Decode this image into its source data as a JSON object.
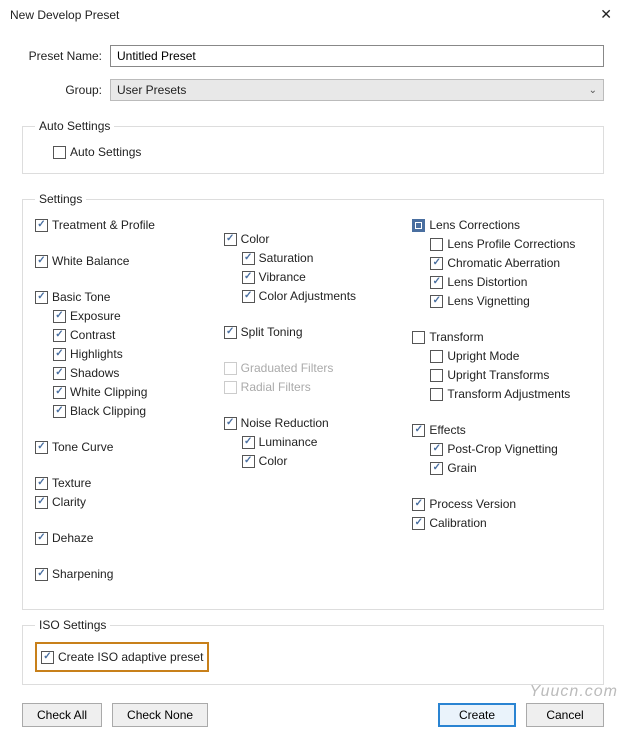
{
  "window": {
    "title": "New Develop Preset"
  },
  "form": {
    "preset_name_label": "Preset Name:",
    "preset_name_value": "Untitled Preset",
    "group_label": "Group:",
    "group_value": "User Presets"
  },
  "auto_settings": {
    "legend": "Auto Settings",
    "auto_settings": {
      "label": "Auto Settings",
      "checked": false
    }
  },
  "settings": {
    "legend": "Settings",
    "col1": {
      "treatment_profile": {
        "label": "Treatment & Profile",
        "checked": true
      },
      "white_balance": {
        "label": "White Balance",
        "checked": true
      },
      "basic_tone": {
        "label": "Basic Tone",
        "checked": true
      },
      "exposure": {
        "label": "Exposure",
        "checked": true
      },
      "contrast": {
        "label": "Contrast",
        "checked": true
      },
      "highlights": {
        "label": "Highlights",
        "checked": true
      },
      "shadows": {
        "label": "Shadows",
        "checked": true
      },
      "white_clipping": {
        "label": "White Clipping",
        "checked": true
      },
      "black_clipping": {
        "label": "Black Clipping",
        "checked": true
      },
      "tone_curve": {
        "label": "Tone Curve",
        "checked": true
      },
      "texture": {
        "label": "Texture",
        "checked": true
      },
      "clarity": {
        "label": "Clarity",
        "checked": true
      },
      "dehaze": {
        "label": "Dehaze",
        "checked": true
      },
      "sharpening": {
        "label": "Sharpening",
        "checked": true
      }
    },
    "col2": {
      "color": {
        "label": "Color",
        "checked": true
      },
      "saturation": {
        "label": "Saturation",
        "checked": true
      },
      "vibrance": {
        "label": "Vibrance",
        "checked": true
      },
      "color_adjustments": {
        "label": "Color Adjustments",
        "checked": true
      },
      "split_toning": {
        "label": "Split Toning",
        "checked": true
      },
      "graduated_filters": {
        "label": "Graduated Filters",
        "checked": false,
        "disabled": true
      },
      "radial_filters": {
        "label": "Radial Filters",
        "checked": false,
        "disabled": true
      },
      "noise_reduction": {
        "label": "Noise Reduction",
        "checked": true
      },
      "luminance": {
        "label": "Luminance",
        "checked": true
      },
      "nr_color": {
        "label": "Color",
        "checked": true
      }
    },
    "col3": {
      "lens_corrections": {
        "label": "Lens Corrections",
        "state": "mixed"
      },
      "lens_profile_corrections": {
        "label": "Lens Profile Corrections",
        "checked": false
      },
      "chromatic_aberration": {
        "label": "Chromatic Aberration",
        "checked": true
      },
      "lens_distortion": {
        "label": "Lens Distortion",
        "checked": true
      },
      "lens_vignetting": {
        "label": "Lens Vignetting",
        "checked": true
      },
      "transform": {
        "label": "Transform",
        "checked": false
      },
      "upright_mode": {
        "label": "Upright Mode",
        "checked": false
      },
      "upright_transforms": {
        "label": "Upright Transforms",
        "checked": false
      },
      "transform_adjustments": {
        "label": "Transform Adjustments",
        "checked": false
      },
      "effects": {
        "label": "Effects",
        "checked": true
      },
      "post_crop_vignetting": {
        "label": "Post-Crop Vignetting",
        "checked": true
      },
      "grain": {
        "label": "Grain",
        "checked": true
      },
      "process_version": {
        "label": "Process Version",
        "checked": true
      },
      "calibration": {
        "label": "Calibration",
        "checked": true
      }
    }
  },
  "iso": {
    "legend": "ISO Settings",
    "create_iso": {
      "label": "Create ISO adaptive preset",
      "checked": true
    }
  },
  "buttons": {
    "check_all": "Check All",
    "check_none": "Check None",
    "create": "Create",
    "cancel": "Cancel"
  },
  "watermark": "Yuucn.com"
}
